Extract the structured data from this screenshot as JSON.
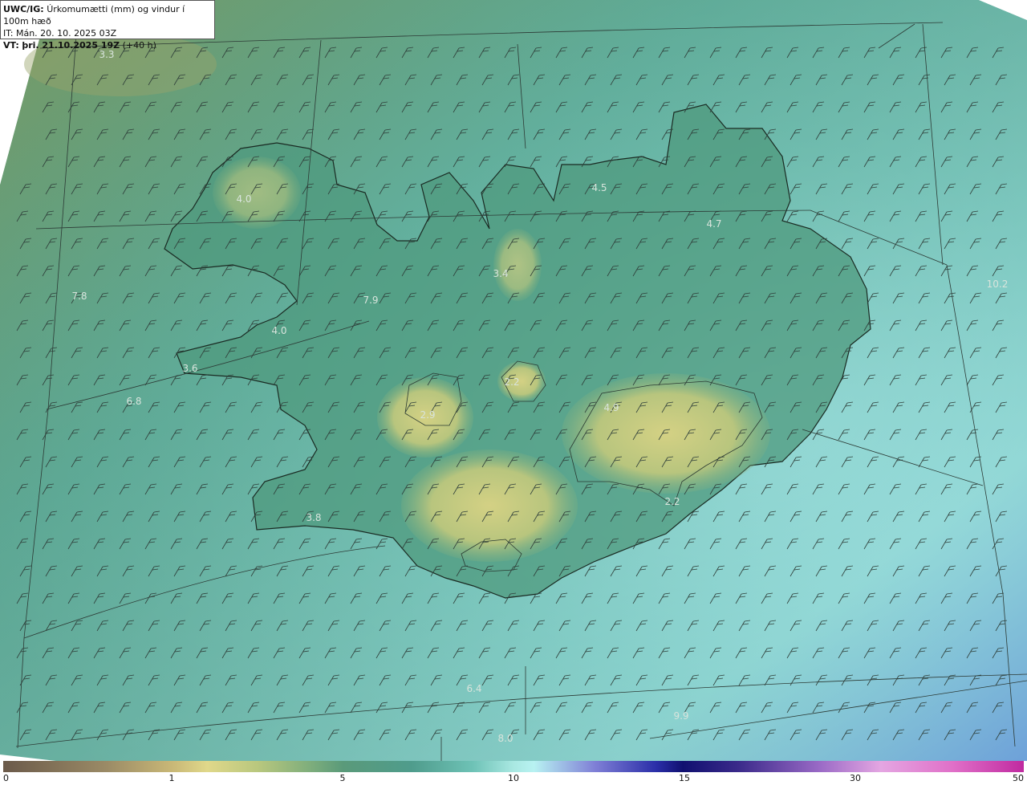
{
  "info": {
    "product": "UWC/IG:",
    "title": "Úrkomumætti (mm) og vindur í 100m hæð",
    "init_time": "IT: Mán. 20. 10. 2025 03Z",
    "valid_prefix": "VT:",
    "valid_time": "þri. 21.10.2025 19Z",
    "lead": "(+40 h)"
  },
  "map_labels": [
    "3.3",
    "4.0",
    "7.8",
    "3.6",
    "6.8",
    "4.0",
    "7.9",
    "3.4",
    "2.2",
    "2.9",
    "3.8",
    "4.5",
    "4.7",
    "10.2",
    "4.9",
    "2.2",
    "6.4",
    "9.9",
    "8.0"
  ],
  "colorbar": {
    "ticks": [
      "0",
      "1",
      "5",
      "10",
      "15",
      "30",
      "50"
    ]
  },
  "colors": {
    "sea": "#5fb4a4",
    "land": "#4f9a7e",
    "highland": "#bcc97c",
    "coast": "#1a2a22",
    "barb": "#2f3f3a"
  },
  "wind": {
    "direction": "southwesterly",
    "speed_kt": 20
  }
}
